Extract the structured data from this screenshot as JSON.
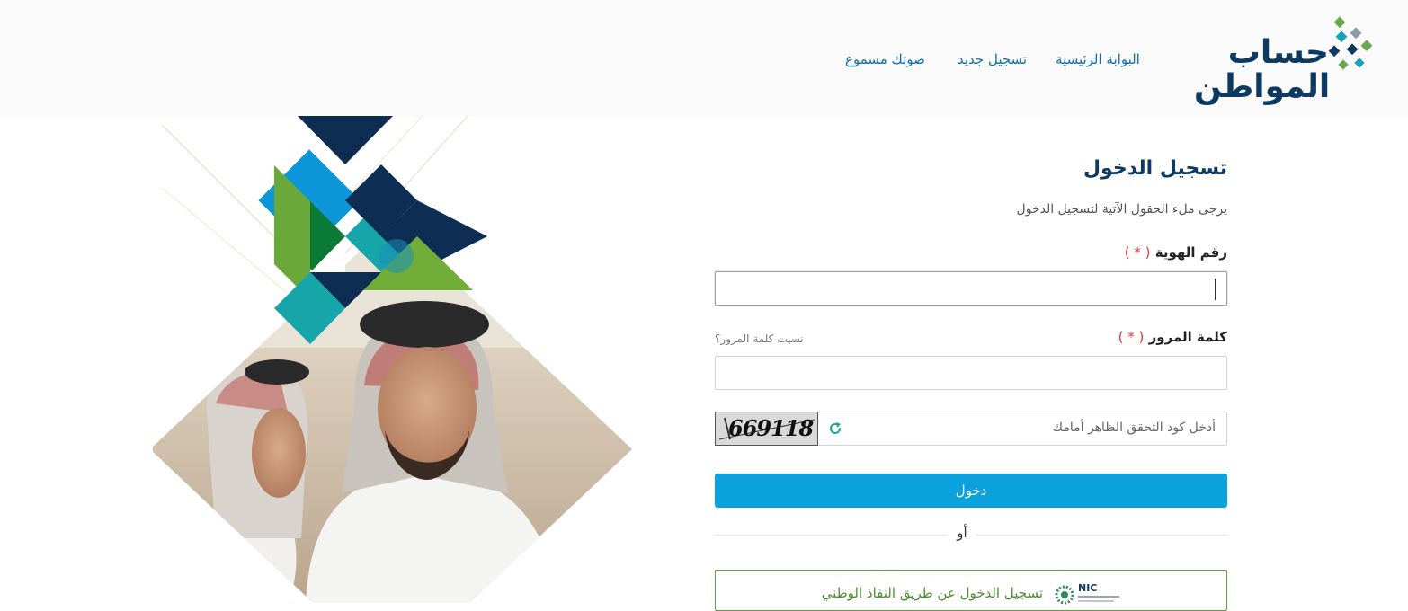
{
  "header": {
    "logo": {
      "line1": "حساب",
      "line2": "المواطن"
    },
    "nav": {
      "home": "البوابة الرئيسية",
      "register": "تسجيل جديد",
      "voice": "صوتك مسموع"
    }
  },
  "form": {
    "title": "تسجيل الدخول",
    "subtitle": "يرجى ملء الحقول الآتية لتسجيل الدخول",
    "id_label": "رقم الهوية",
    "password_label": "كلمة المرور",
    "required_mark": "( * )",
    "forgot_password": "نسيت كلمة المرور؟",
    "captcha_placeholder": "أدخل كود التحقق الظاهر أمامك",
    "captcha_code": "669118",
    "login_button": "دخول",
    "or": "أو",
    "nafath_button": "تسجيل الدخول عن طريق النفاذ الوطني",
    "nic_logo_text": "NIC"
  },
  "colors": {
    "brand_navy": "#0d3a63",
    "link_blue": "#0d6fb8",
    "button_blue": "#0aa1dd",
    "nafath_green": "#5aa33b",
    "required_red": "#e53935"
  }
}
